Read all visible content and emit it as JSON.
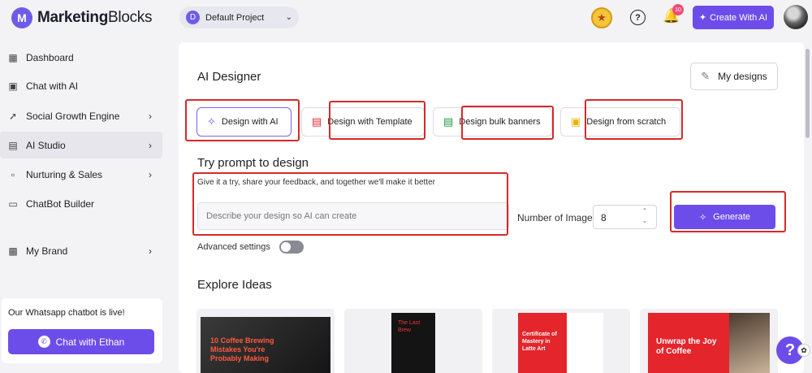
{
  "app": {
    "logo_mark": "M",
    "logo_bold": "Marketing",
    "logo_light": "Blocks"
  },
  "header": {
    "project_initial": "D",
    "project_name": "Default Project",
    "notification_count": "10",
    "create_ai_label": "Create With AI"
  },
  "sidebar": {
    "items": [
      {
        "label": "Dashboard",
        "icon": "dashboard-icon"
      },
      {
        "label": "Chat with AI",
        "icon": "chat-icon"
      },
      {
        "label": "Social Growth Engine",
        "icon": "rocket-icon"
      },
      {
        "label": "AI Studio",
        "icon": "studio-icon"
      },
      {
        "label": "Nurturing & Sales",
        "icon": "nurture-icon"
      },
      {
        "label": "ChatBot Builder",
        "icon": "bot-icon"
      },
      {
        "label": "My Brand",
        "icon": "brand-icon"
      }
    ],
    "whatsapp_text": "Our Whatsapp chatbot is live!",
    "whatsapp_button": "Chat with Ethan"
  },
  "main": {
    "title": "AI Designer",
    "my_designs": "My designs",
    "tabs": [
      {
        "label": "Design with AI"
      },
      {
        "label": "Design with Template"
      },
      {
        "label": "Design bulk banners"
      },
      {
        "label": "Design from scratch"
      }
    ],
    "try_title": "Try prompt to design",
    "try_subtitle": "Give it a try, share your feedback, and together we'll make it better",
    "prompt_placeholder": "Describe your design so AI can create",
    "number_label": "Number of Image",
    "number_value": "8",
    "generate_label": "Generate",
    "advanced_label": "Advanced settings",
    "explore_title": "Explore Ideas",
    "cards": [
      {
        "text": "10 Coffee Brewing Mistakes You're Probably Making"
      },
      {
        "text": "The Last Brew"
      },
      {
        "text": "Certificate of Mastery in Latte Art"
      },
      {
        "text": "Unwrap the Joy of Coffee"
      }
    ]
  },
  "colors": {
    "accent": "#6d4dea",
    "highlight": "#d42a2a"
  }
}
